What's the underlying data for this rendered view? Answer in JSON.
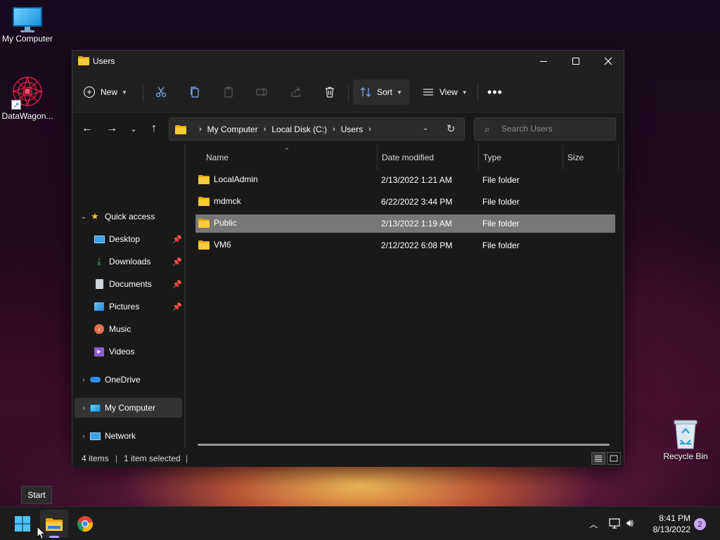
{
  "desktop": {
    "icons": [
      {
        "label": "My Computer"
      },
      {
        "label": "DataWagon..."
      },
      {
        "label": "Recycle Bin"
      }
    ]
  },
  "window": {
    "title": "Users",
    "controls": {
      "minimize": "minimize",
      "maximize": "maximize",
      "close": "close"
    }
  },
  "toolbar": {
    "new_label": "New",
    "sort_label": "Sort",
    "view_label": "View",
    "more_label": "•••"
  },
  "address": {
    "crumbs": [
      "My Computer",
      "Local Disk (C:)",
      "Users"
    ]
  },
  "search": {
    "placeholder": "Search Users"
  },
  "nav": {
    "quick_access": "Quick access",
    "items": [
      {
        "label": "Desktop",
        "pinned": true
      },
      {
        "label": "Downloads",
        "pinned": true
      },
      {
        "label": "Documents",
        "pinned": true
      },
      {
        "label": "Pictures",
        "pinned": true
      },
      {
        "label": "Music",
        "pinned": false
      },
      {
        "label": "Videos",
        "pinned": false
      }
    ],
    "onedrive": "OneDrive",
    "my_computer": "My Computer",
    "network": "Network"
  },
  "columns": {
    "name": "Name",
    "date": "Date modified",
    "type": "Type",
    "size": "Size"
  },
  "files": [
    {
      "name": "LocalAdmin",
      "date": "2/13/2022 1:21 AM",
      "type": "File folder",
      "selected": false
    },
    {
      "name": "mdmck",
      "date": "6/22/2022 3:44 PM",
      "type": "File folder",
      "selected": false
    },
    {
      "name": "Public",
      "date": "2/13/2022 1:19 AM",
      "type": "File folder",
      "selected": true
    },
    {
      "name": "VM6",
      "date": "2/12/2022 6:08 PM",
      "type": "File folder",
      "selected": false
    }
  ],
  "status": {
    "items": "4 items",
    "separator": "|",
    "selected": "1 item selected"
  },
  "tooltip": {
    "start": "Start"
  },
  "taskbar": {
    "time": "8:41 PM",
    "date": "8/13/2022",
    "notifications": "2"
  },
  "colors": {
    "accent": "#0078d4",
    "folder": "#f8ca3c",
    "selected_row": "#777777",
    "window_bg": "#191919"
  }
}
